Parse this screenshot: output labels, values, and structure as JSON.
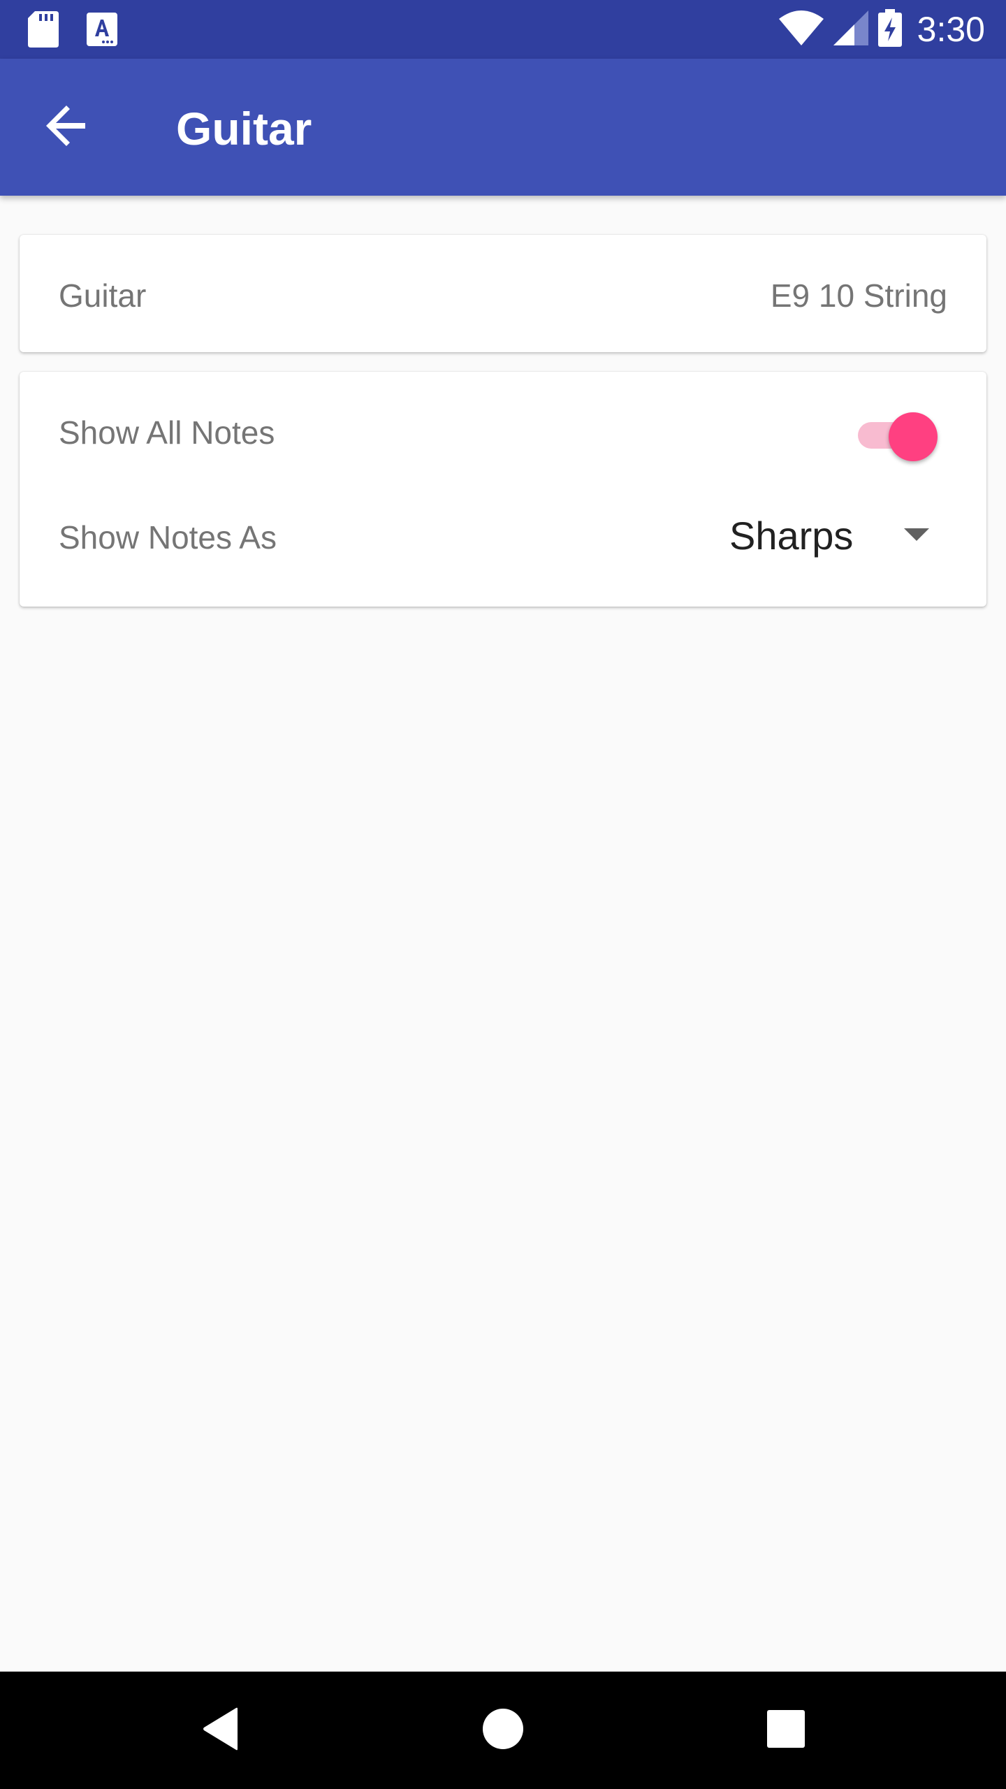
{
  "status_bar": {
    "time": "3:30",
    "icons": [
      "sd-card-icon",
      "text-a-icon",
      "wifi-icon",
      "cell-signal-icon",
      "battery-charging-icon"
    ]
  },
  "app_bar": {
    "title": "Guitar",
    "back_icon": "arrow-back-icon"
  },
  "instrument_card": {
    "label": "Guitar",
    "value": "E9 10 String"
  },
  "options_card": {
    "show_all_notes_label": "Show All Notes",
    "show_all_notes_on": true,
    "show_notes_as_label": "Show Notes As",
    "show_notes_as_value": "Sharps"
  },
  "nav_bar": {
    "buttons": [
      "back-triangle-icon",
      "home-circle-icon",
      "recents-square-icon"
    ]
  },
  "colors": {
    "primary": "#3f51b5",
    "primary_dark": "#303f9f",
    "accent": "#ff4081",
    "accent_light": "#f8bbd0"
  }
}
